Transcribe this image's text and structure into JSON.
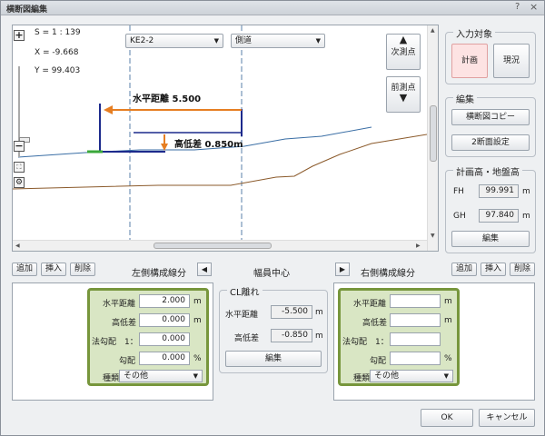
{
  "window": {
    "title": "横断図編集",
    "help_glyph": "?",
    "close_glyph": "×"
  },
  "canvas": {
    "info": {
      "scale": "S = 1 : 139",
      "x": "X = -9.668",
      "y": "Y = 99.403"
    },
    "station_dropdown": "KE2-2",
    "side_dropdown": "側道",
    "next_station": "次測点",
    "prev_station": "前測点",
    "horizontal_distance_label": "水平距離 5.500",
    "elevation_diff_label": "高低差 0.850m",
    "colors": {
      "plan_line": "#1c2a8c",
      "ground_line": "#8b5a2b",
      "dim_arrow": "#e67e22",
      "green_line": "#3aa83a",
      "centerline": "#5a7fa8"
    }
  },
  "right": {
    "input_target": {
      "title": "入力対象",
      "plan": "計画",
      "current": "現況"
    },
    "edit": {
      "title": "編集",
      "copy": "横断図コピー",
      "two_sections": "2断面設定"
    },
    "heights": {
      "title": "計画高・地盤高",
      "fh_label": "FH",
      "fh_value": "99.991",
      "gh_label": "GH",
      "gh_value": "97.840",
      "unit": "m",
      "edit": "編集"
    }
  },
  "bottom_bar": {
    "add_left": "追加",
    "insert_left": "挿入",
    "delete_left": "削除",
    "left_title": "左側構成線分",
    "left_arrow": "◀",
    "center_title": "幅員中心",
    "right_arrow": "▶",
    "right_title": "右側構成線分",
    "add_right": "追加",
    "insert_right": "挿入",
    "delete_right": "削除"
  },
  "left_panel": {
    "h_dist_label": "水平距離",
    "h_dist": "2.000",
    "h_unit": "m",
    "elev_label": "高低差",
    "elev": "0.000",
    "elev_unit": "m",
    "slope_label": "法勾配　1：",
    "slope": "0.000",
    "grade_label": "勾配",
    "grade": "0.000",
    "grade_unit": "%",
    "type_label": "種類",
    "type": "その他"
  },
  "center_panel": {
    "title": "CL離れ",
    "h_dist_label": "水平距離",
    "h_dist": "-5.500",
    "h_unit": "m",
    "elev_label": "高低差",
    "elev": "-0.850",
    "elev_unit": "m",
    "edit": "編集"
  },
  "right_panel": {
    "h_dist_label": "水平距離",
    "h_dist": "",
    "h_unit": "m",
    "elev_label": "高低差",
    "elev": "",
    "elev_unit": "m",
    "slope_label": "法勾配　1：",
    "slope": "",
    "grade_label": "勾配",
    "grade": "",
    "grade_unit": "%",
    "type_label": "種類",
    "type": "その他"
  },
  "footer": {
    "ok": "OK",
    "cancel": "キャンセル"
  }
}
